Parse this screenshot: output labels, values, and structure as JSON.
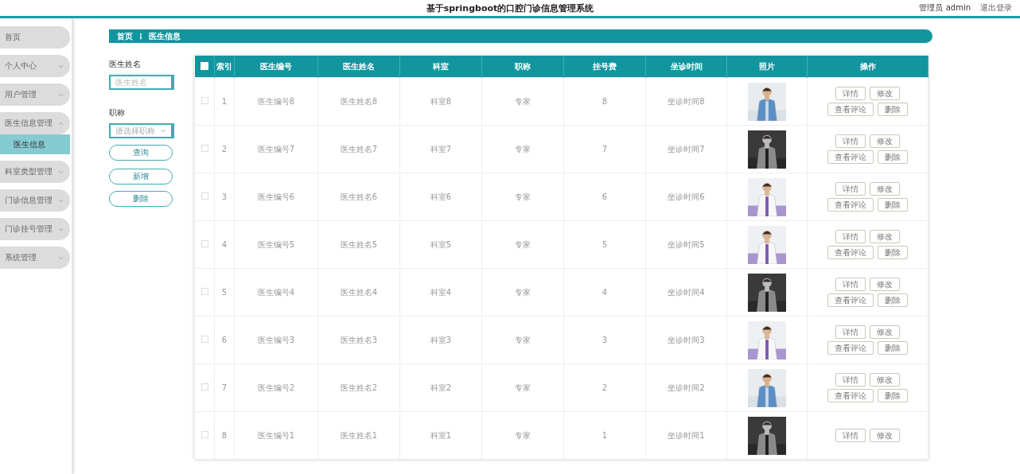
{
  "header": {
    "title": "基于springboot的口腔门诊信息管理系统",
    "user": "管理员 admin",
    "logout": "退出登录"
  },
  "sidebar": {
    "items": [
      {
        "label": "首页"
      },
      {
        "label": "个人中心",
        "expanded": false
      },
      {
        "label": "用户管理",
        "expanded": false
      },
      {
        "label": "医生信息管理",
        "expanded": true,
        "children": [
          {
            "label": "医生信息",
            "selected": true
          }
        ]
      },
      {
        "label": "科室类型管理",
        "expanded": false
      },
      {
        "label": "门诊信息管理",
        "expanded": false
      },
      {
        "label": "门诊挂号管理",
        "expanded": false
      },
      {
        "label": "系统管理",
        "expanded": false
      }
    ]
  },
  "breadcrumb": {
    "items": [
      "首页",
      "医生信息"
    ],
    "separator": "⋮"
  },
  "filters": {
    "name_label": "医生姓名",
    "name_placeholder": "医生姓名",
    "title_label": "职称",
    "title_placeholder": "请选择职称",
    "buttons": [
      "查询",
      "新增",
      "删除"
    ]
  },
  "table": {
    "all_checked": false,
    "columns": [
      "索引",
      "医生编号",
      "医生姓名",
      "科室",
      "职称",
      "挂号费",
      "坐诊时间",
      "照片",
      "操作"
    ],
    "rows": [
      {
        "checked": false,
        "cells": [
          "1",
          "医生编号8",
          "医生姓名8",
          "科室8",
          "专家",
          "8",
          "坐诊时间8"
        ],
        "photo": {
          "kind": "picture"
        },
        "actions": [
          "详情",
          "修改",
          "查看评论",
          "删除"
        ]
      },
      {
        "checked": false,
        "cells": [
          "2",
          "医生编号7",
          "医生姓名7",
          "科室7",
          "专家",
          "7",
          "坐诊时间7"
        ],
        "photo": {
          "kind": "picture"
        },
        "actions": [
          "详情",
          "修改",
          "查看评论",
          "删除"
        ]
      },
      {
        "checked": false,
        "cells": [
          "3",
          "医生编号6",
          "医生姓名6",
          "科室6",
          "专家",
          "6",
          "坐诊时间6"
        ],
        "photo": {
          "kind": "picture"
        },
        "actions": [
          "详情",
          "修改",
          "查看评论",
          "删除"
        ]
      },
      {
        "checked": false,
        "cells": [
          "4",
          "医生编号5",
          "医生姓名5",
          "科室5",
          "专家",
          "5",
          "坐诊时间5"
        ],
        "photo": {
          "kind": "picture"
        },
        "actions": [
          "详情",
          "修改",
          "查看评论",
          "删除"
        ]
      },
      {
        "checked": false,
        "cells": [
          "5",
          "医生编号4",
          "医生姓名4",
          "科室4",
          "专家",
          "4",
          "坐诊时间4"
        ],
        "photo": {
          "kind": "picture"
        },
        "actions": [
          "详情",
          "修改",
          "查看评论",
          "删除"
        ]
      },
      {
        "checked": false,
        "cells": [
          "6",
          "医生编号3",
          "医生姓名3",
          "科室3",
          "专家",
          "3",
          "坐诊时间3"
        ],
        "photo": {
          "kind": "picture"
        },
        "actions": [
          "详情",
          "修改",
          "查看评论",
          "删除"
        ]
      },
      {
        "checked": false,
        "cells": [
          "7",
          "医生编号2",
          "医生姓名2",
          "科室2",
          "专家",
          "2",
          "坐诊时间2"
        ],
        "photo": {
          "kind": "picture"
        },
        "actions": [
          "详情",
          "修改",
          "查看评论",
          "删除"
        ]
      },
      {
        "checked": false,
        "cells": [
          "8",
          "医生编号1",
          "医生姓名1",
          "科室1",
          "专家",
          "1",
          "坐诊时间1"
        ],
        "photo": {
          "kind": "picture"
        },
        "actions": [
          "详情",
          "修改"
        ]
      }
    ]
  }
}
